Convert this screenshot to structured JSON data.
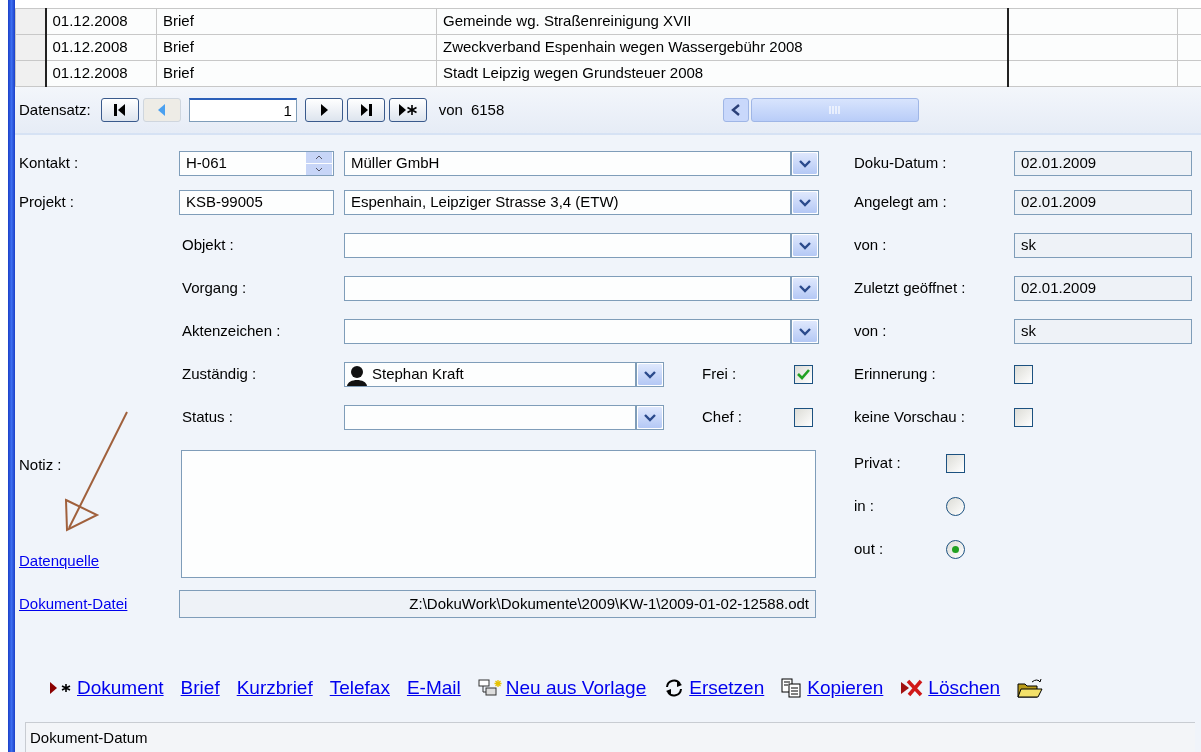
{
  "table": {
    "rows": [
      {
        "column_1": "01.12.2008",
        "column_2": "Brief",
        "column_3": "Gemeinde wg. Straßenreinigung XVII"
      },
      {
        "column_1": "01.12.2008",
        "column_2": "Brief",
        "column_3": "Zweckverband Espenhain wegen Wassergebühr 2008"
      },
      {
        "column_1": "01.12.2008",
        "column_2": "Brief",
        "column_3": "Stadt Leipzig wegen Grundsteuer 2008"
      }
    ]
  },
  "record_nav": {
    "label": "Datensatz:",
    "current": "1",
    "of_label": "von",
    "total": "6158",
    "buttons": [
      {
        "kind": "first",
        "disabled": false
      },
      {
        "kind": "prev",
        "disabled": true
      },
      {
        "kind": "next",
        "disabled": false
      },
      {
        "kind": "last",
        "disabled": false
      },
      {
        "kind": "new",
        "disabled": false
      }
    ]
  },
  "contact": {
    "label": "Kontakt :",
    "code": "H-061",
    "name": "Müller GmbH"
  },
  "project": {
    "label": "Projekt :",
    "code": "KSB-99005",
    "name": "Espenhain, Leipziger Strasse 3,4 (ETW)"
  },
  "lookups": [
    {
      "label": "Objekt :"
    },
    {
      "label": "Vorgang :"
    },
    {
      "label": "Aktenzeichen :"
    }
  ],
  "responsible": {
    "label": "Zuständig :",
    "value": "Stephan Kraft"
  },
  "status": {
    "label": "Status :"
  },
  "flags": [
    {
      "label": "Frei :",
      "checked": true
    },
    {
      "label": "Chef :",
      "checked": false
    }
  ],
  "details": [
    {
      "kind": "field",
      "label": "Doku-Datum :",
      "value": "02.01.2009"
    },
    {
      "kind": "field",
      "label": "Angelegt am :",
      "value": "02.01.2009"
    },
    {
      "kind": "field",
      "label": "von :",
      "value": "sk"
    },
    {
      "kind": "field",
      "label": "Zuletzt geöffnet :",
      "value": "02.01.2009"
    },
    {
      "kind": "field",
      "label": "von :",
      "value": "sk"
    },
    {
      "kind": "checkbox",
      "label": "Erinnerung :",
      "checked": false
    },
    {
      "kind": "checkbox",
      "label": "keine Vorschau :",
      "checked": false
    }
  ],
  "privacy": {
    "label": "Privat :",
    "checked": false
  },
  "direction": [
    {
      "label": "in :",
      "selected": false
    },
    {
      "label": "out :",
      "selected": true
    }
  ],
  "note": {
    "label": "Notiz :"
  },
  "source_link": "Datenquelle",
  "file": {
    "link": "Dokument-Datei",
    "path": "Z:\\DokuWork\\Dokumente\\2009\\KW-1\\2009-01-02-12588.odt"
  },
  "actions": [
    {
      "kind": "new",
      "label": "Dokument"
    },
    {
      "kind": "link",
      "label": "Brief"
    },
    {
      "kind": "link",
      "label": "Kurzbrief"
    },
    {
      "kind": "link",
      "label": "Telefax"
    },
    {
      "kind": "link",
      "label": "E-Mail"
    },
    {
      "kind": "template",
      "label": "Neu aus Vorlage"
    },
    {
      "kind": "replace",
      "label": "Ersetzen"
    },
    {
      "kind": "copy",
      "label": "Kopieren"
    },
    {
      "kind": "delete",
      "label": "Löschen"
    },
    {
      "kind": "open"
    }
  ],
  "status_bar": "Dokument-Datum"
}
